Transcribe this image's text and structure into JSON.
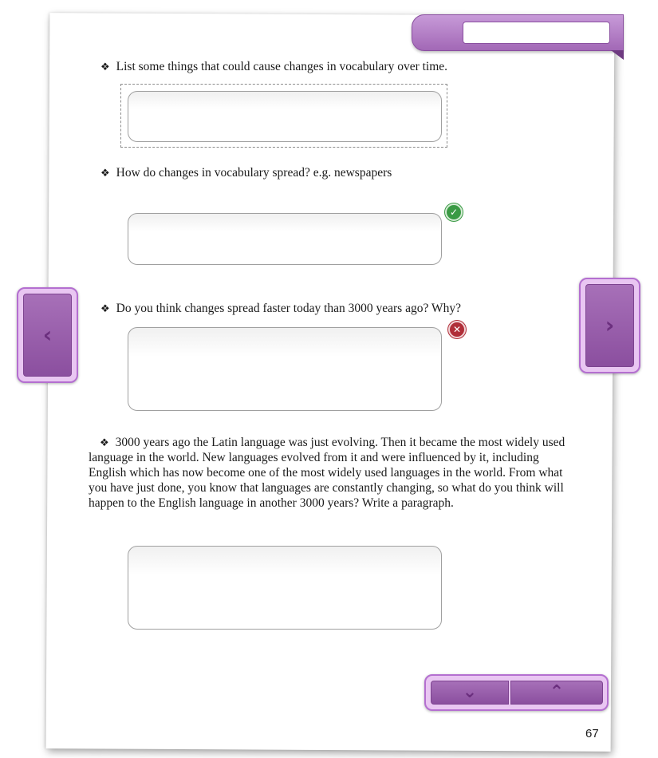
{
  "header": {
    "search_value": ""
  },
  "questions": [
    {
      "text": "List some things that could cause changes in vocabulary over time.",
      "answer": "",
      "status": "none"
    },
    {
      "text": "How do changes in vocabulary spread? e.g. newspapers",
      "answer": "",
      "status": "correct"
    },
    {
      "text": "Do you think changes spread faster today than 3000 years ago? Why?",
      "answer": "",
      "status": "incorrect"
    }
  ],
  "paragraph_task": {
    "text": "3000 years ago the Latin language was just evolving. Then it became the most widely used language in the world. New languages evolved from it and were influenced by it, including English which has now become one of the most widely used languages in the world. From what you have just done, you know that languages are constantly changing, so what do you think will happen to the English language in another 3000 years?  Write a paragraph.",
    "answer": ""
  },
  "bullet_glyph": "❖",
  "icons": {
    "prev": "chevron-left-icon",
    "next": "chevron-right-icon",
    "down": "chevron-down-icon",
    "up": "chevron-up-icon",
    "correct": "check-circle-icon",
    "incorrect": "x-circle-icon"
  },
  "colors": {
    "accent": "#a268b6",
    "correct": "#3a9a44",
    "incorrect": "#b02e38"
  },
  "page_number": "67"
}
